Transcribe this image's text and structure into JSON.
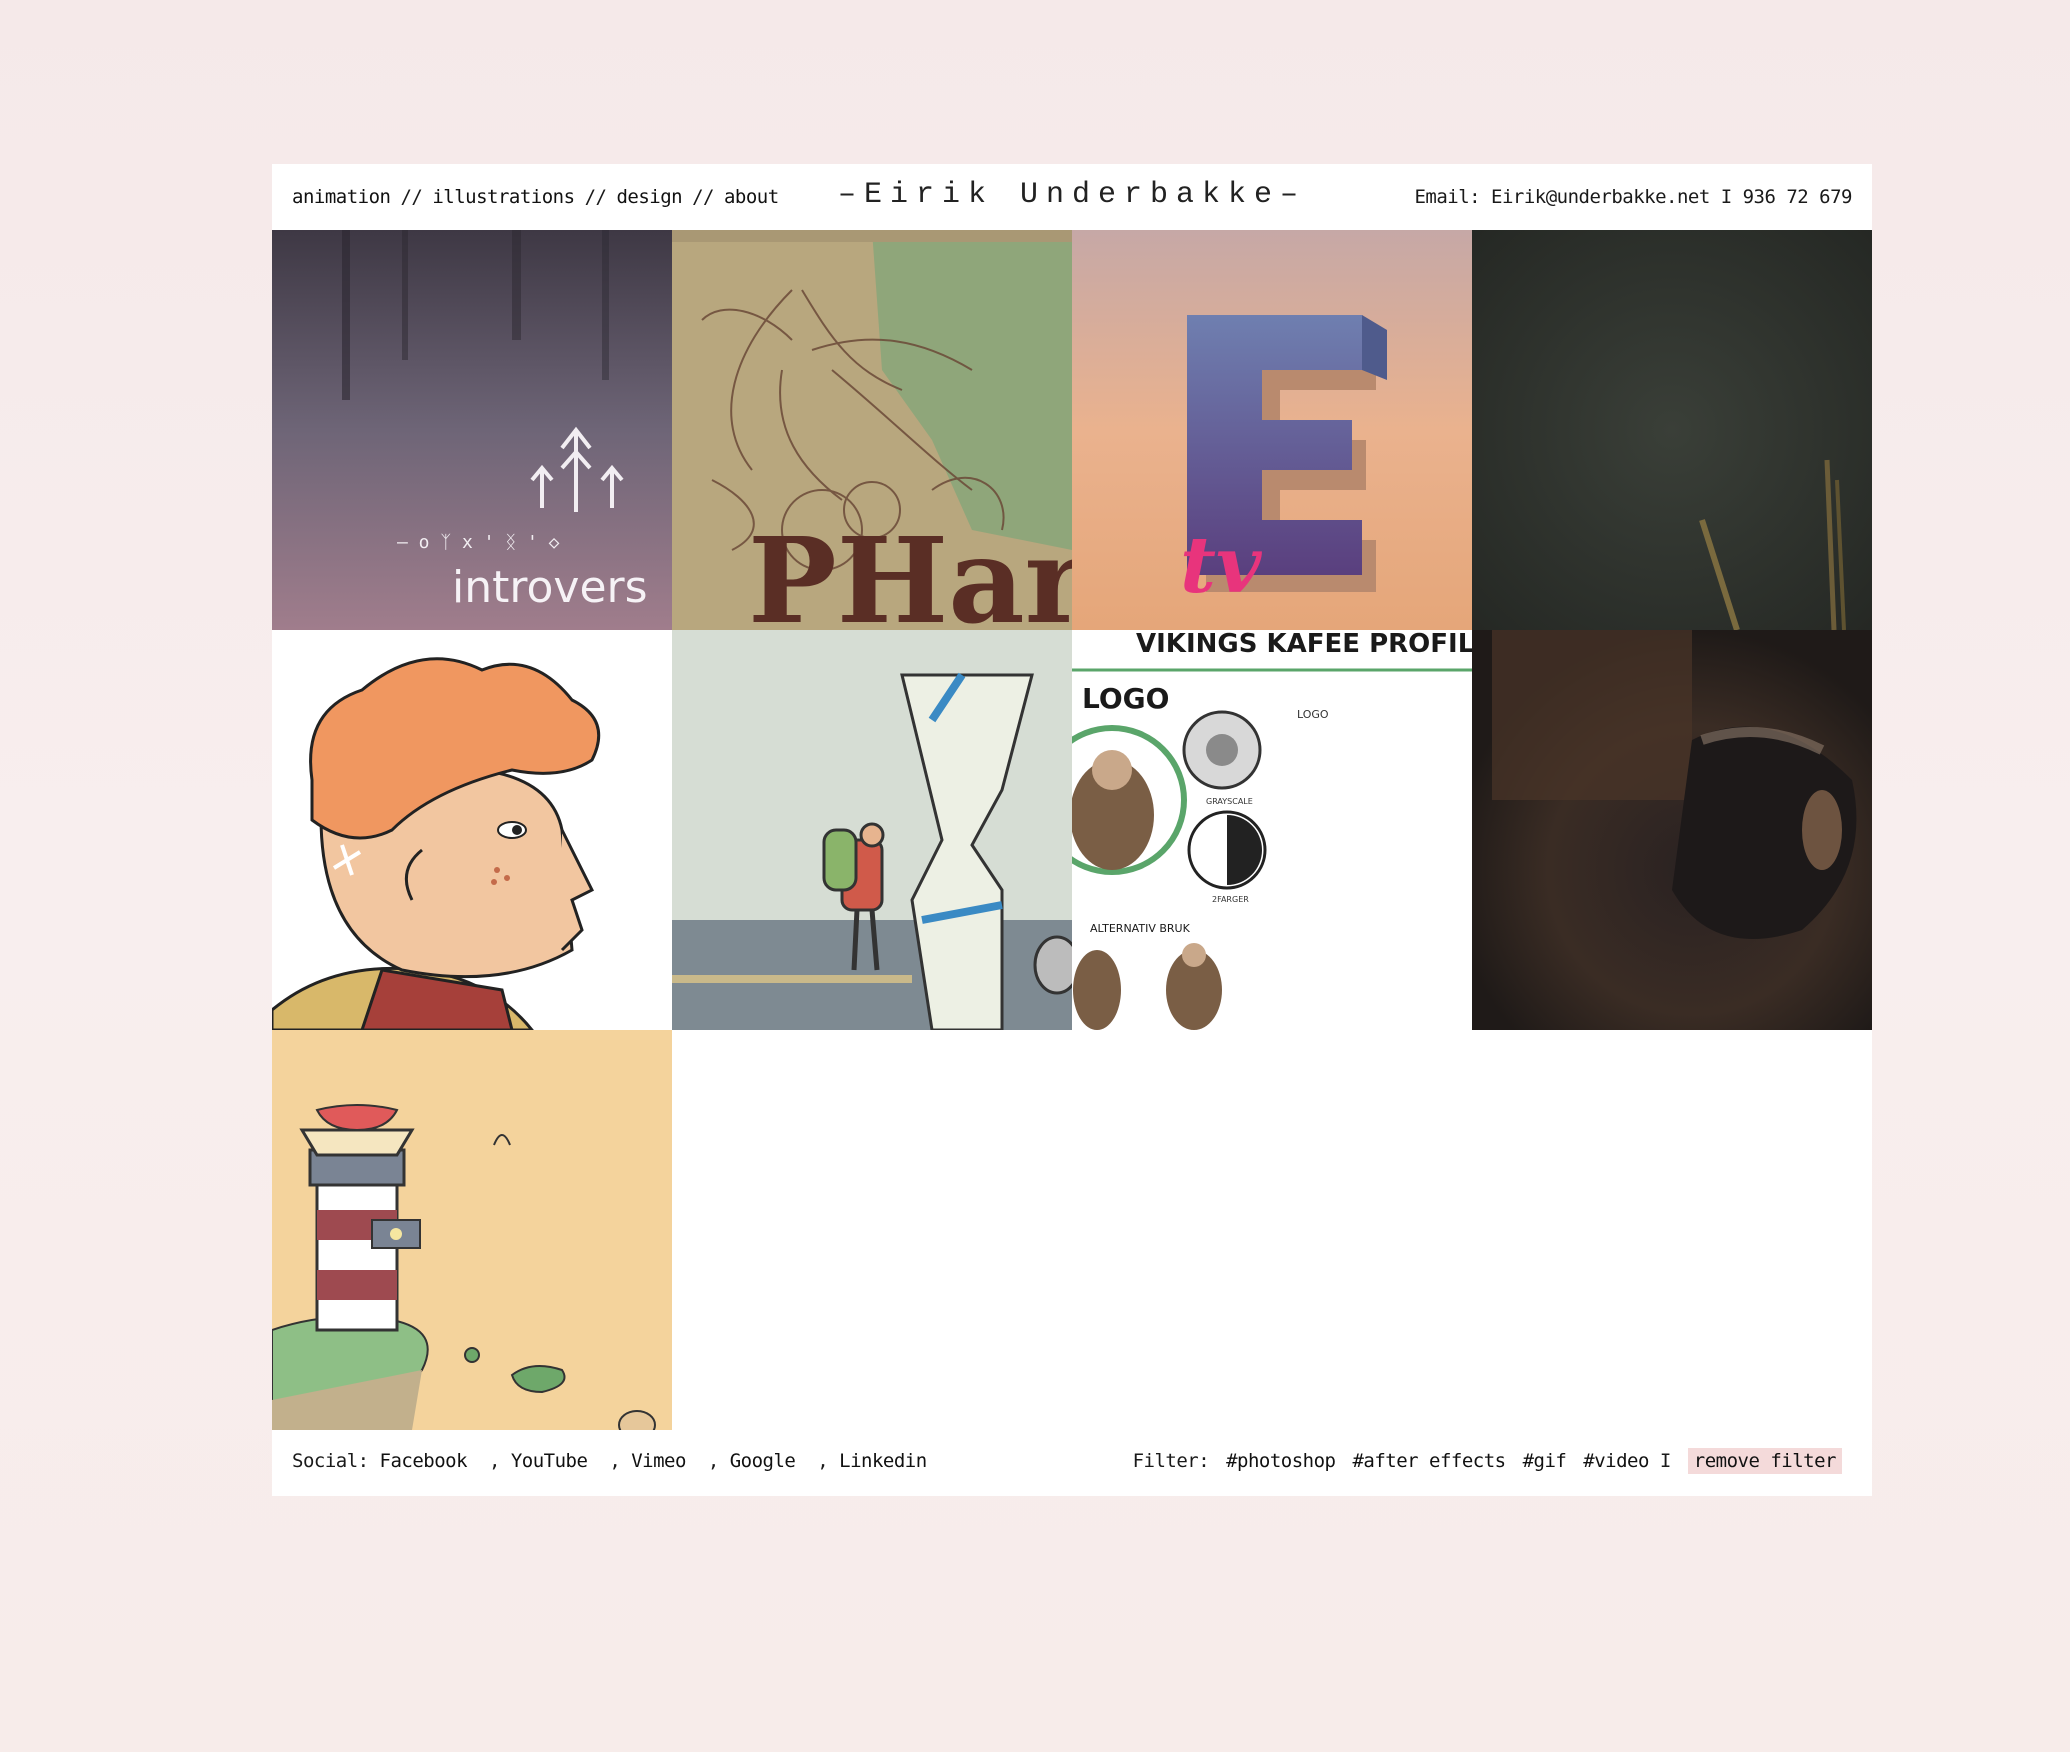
{
  "nav": {
    "items": [
      "animation",
      "illustrations",
      "design",
      "about"
    ],
    "separator": "//"
  },
  "brand": {
    "title": "–Eirik Underbakke–"
  },
  "contact": {
    "text": "Email: Eirik@underbakke.net I 936 72 679"
  },
  "tiles": {
    "introvert": {
      "caption": "introvers",
      "runes": "– o ᛉ x ' ᛝ ' ◇"
    },
    "pharma": {
      "caption": "PHarr"
    },
    "etv": {
      "caption": "tv"
    },
    "vikings": {
      "title": "VIKINGS KAFEE PROFIL",
      "logo": "LOGO",
      "logo_small": "LOGO",
      "grayscale": "GRAYSCALE",
      "twofarger": "2FARGER",
      "alt": "ALTERNATIV BRUK"
    }
  },
  "footer": {
    "social_label": "Social:",
    "social_links": [
      "Facebook",
      "YouTube",
      "Vimeo",
      "Google",
      "Linkedin"
    ],
    "filter_label": "Filter:",
    "filters": [
      "#photoshop",
      "#after effects",
      "#gif",
      "#video"
    ],
    "filter_sep": "I",
    "remove_filter": "remove filter"
  }
}
